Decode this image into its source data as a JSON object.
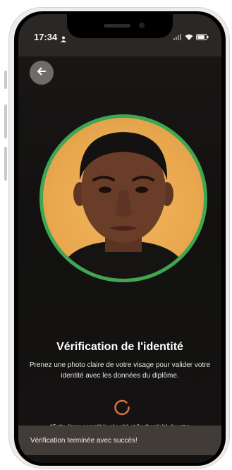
{
  "status_bar": {
    "time": "17:34",
    "icons": [
      "person-icon",
      "signal-icon",
      "wifi-icon",
      "battery-icon"
    ]
  },
  "header": {
    "back_icon": "arrow-left-icon"
  },
  "main": {
    "title": "Vérification de l'identité",
    "subtitle": "Prenez une photo claire de votre visage pour valider votre identité avec les données du diplôme.",
    "note": "*Cette étape garantit la sécurité et l'authenticité de votre"
  },
  "toast": {
    "message": "Vérification terminée avec succès!"
  },
  "colors": {
    "ring": "#3fa652",
    "spinner": "#d8733e",
    "toast_bg": "#423c38",
    "photo_bg": "#e9a84e"
  }
}
